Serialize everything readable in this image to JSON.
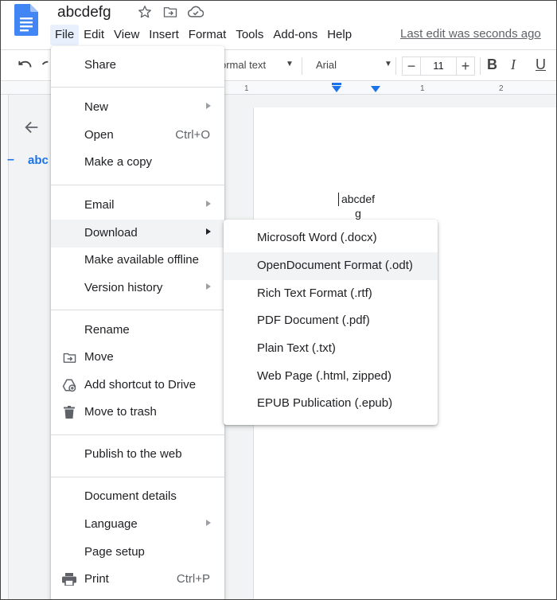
{
  "app": {
    "document_title": "abcdefg",
    "menubar": [
      "File",
      "Edit",
      "View",
      "Insert",
      "Format",
      "Tools",
      "Add-ons",
      "Help"
    ],
    "last_edit": "Last edit was seconds ago"
  },
  "toolbar": {
    "style": "ormal text",
    "font": "Arial",
    "font_size": "11",
    "bold": "B",
    "italic": "I",
    "underline": "U"
  },
  "ruler": {
    "ticks": [
      "1",
      "1",
      "2"
    ]
  },
  "outline": {
    "item": "abc"
  },
  "document": {
    "line1": "abcdef",
    "line2": "g"
  },
  "file_menu": {
    "share": "Share",
    "new": "New",
    "open": "Open",
    "open_shortcut": "Ctrl+O",
    "make_copy": "Make a copy",
    "email": "Email",
    "download": "Download",
    "make_offline": "Make available offline",
    "version_history": "Version history",
    "rename": "Rename",
    "move": "Move",
    "add_shortcut": "Add shortcut to Drive",
    "move_trash": "Move to trash",
    "publish": "Publish to the web",
    "doc_details": "Document details",
    "language": "Language",
    "page_setup": "Page setup",
    "print": "Print",
    "print_shortcut": "Ctrl+P"
  },
  "download_menu": [
    "Microsoft Word (.docx)",
    "OpenDocument Format (.odt)",
    "Rich Text Format (.rtf)",
    "PDF Document (.pdf)",
    "Plain Text (.txt)",
    "Web Page (.html, zipped)",
    "EPUB Publication (.epub)"
  ],
  "colors": {
    "accent": "#1a73e8",
    "highlight": "#f1f3f4",
    "menu_active": "#e8f0fe"
  }
}
